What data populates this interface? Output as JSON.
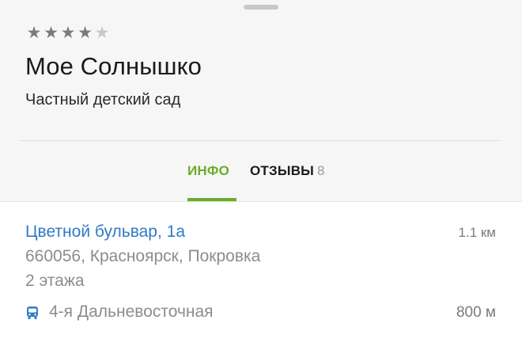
{
  "rating": {
    "stars": [
      "★",
      "★",
      "★",
      "★",
      "★"
    ],
    "value": 4,
    "max": 5
  },
  "place": {
    "name": "Мое Солнышко",
    "category": "Частный детский сад"
  },
  "tabs": [
    {
      "label": "ИНФО",
      "active": true
    },
    {
      "label": "ОТЗЫВЫ",
      "count": "8",
      "active": false
    }
  ],
  "address": {
    "street": "Цветной бульвар, 1а",
    "distance": "1.1 км",
    "postal_line": "660056, Красноярск, Покровка",
    "floors": "2 этажа"
  },
  "transit": {
    "icon": "bus-icon",
    "stop_name": "4-я Дальневосточная",
    "distance": "800 м"
  },
  "colors": {
    "accent_green": "#6aac2a",
    "link_blue": "#2f7bc7",
    "header_bg": "#f6f6f6"
  }
}
